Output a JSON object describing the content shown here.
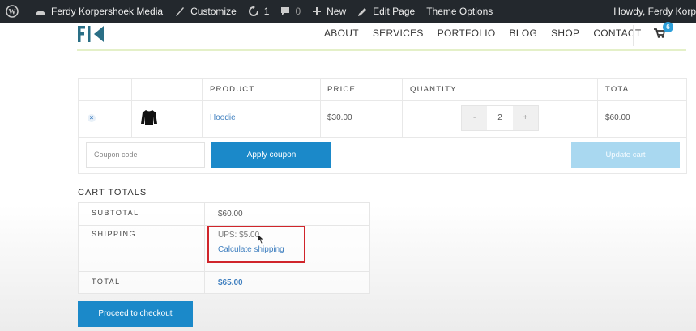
{
  "admin_bar": {
    "site_name": "Ferdy Korpershoek Media",
    "customize": "Customize",
    "updates_count": "1",
    "comments_count": "0",
    "new": "New",
    "edit_page": "Edit Page",
    "theme_options": "Theme Options",
    "howdy": "Howdy, Ferdy Korp"
  },
  "nav": {
    "items": [
      "ABOUT",
      "SERVICES",
      "PORTFOLIO",
      "BLOG",
      "SHOP",
      "CONTACT"
    ],
    "cart_count": "6"
  },
  "cart": {
    "headers": {
      "product": "PRODUCT",
      "price": "PRICE",
      "quantity": "QUANTITY",
      "total": "TOTAL"
    },
    "items": [
      {
        "remove": "×",
        "name": "Hoodie",
        "price": "$30.00",
        "quantity": "2",
        "total": "$60.00"
      }
    ],
    "qty_minus": "-",
    "qty_plus": "+",
    "coupon_placeholder": "Coupon code",
    "apply_coupon": "Apply coupon",
    "update_cart": "Update cart"
  },
  "totals": {
    "heading": "CART TOTALS",
    "subtotal_label": "SUBTOTAL",
    "subtotal_value": "$60.00",
    "shipping_label": "SHIPPING",
    "shipping_value": "UPS: $5.00",
    "calculate_shipping": "Calculate shipping",
    "total_label": "TOTAL",
    "total_value": "$65.00",
    "checkout": "Proceed to checkout"
  },
  "colors": {
    "admin_bar_bg": "#23282d",
    "accent": "#1b89c9",
    "link": "#3f7fbf",
    "highlight": "#d0252b"
  }
}
